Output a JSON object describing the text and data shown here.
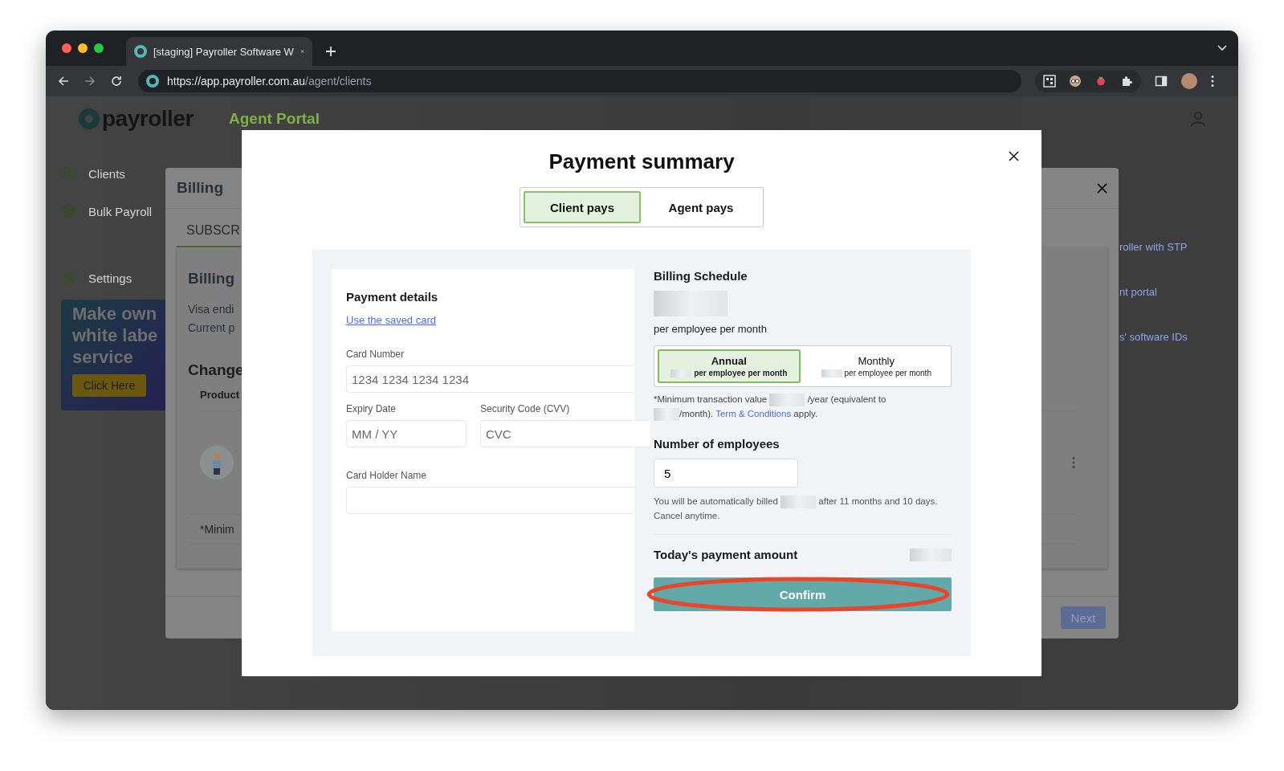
{
  "browser": {
    "tab_title": "[staging] Payroller Software W",
    "url_host": "https://app.payroller.com.au",
    "url_path": "/agent/clients"
  },
  "app": {
    "logo": "payroller",
    "portal_title": "Agent Portal"
  },
  "sidebar": {
    "items": [
      {
        "label": "Clients",
        "kind": "users"
      },
      {
        "label": "Bulk Payroll",
        "kind": "layers"
      },
      {
        "label": "Settings",
        "kind": "gear"
      }
    ],
    "promo": {
      "lines": [
        "Make own",
        "white labe",
        "service"
      ],
      "button": "Click Here"
    }
  },
  "background_links": [
    "roller with STP",
    "nt portal",
    "s' software IDs"
  ],
  "billing_dialog": {
    "title": "Billing",
    "tab": "SUBSCR",
    "section_title": "Billing",
    "lines": [
      "Visa endi",
      "Current p"
    ],
    "change_title": "Change",
    "column_header": "Product",
    "footnote": "*Minim",
    "next_button": "Next"
  },
  "payment_modal": {
    "title": "Payment summary",
    "payer_tabs": [
      {
        "label": "Client pays",
        "selected": true
      },
      {
        "label": "Agent pays",
        "selected": false
      }
    ],
    "payment_details": {
      "title": "Payment details",
      "saved_card_link": "Use the saved card",
      "card_number": {
        "label": "Card Number",
        "placeholder": "1234 1234 1234 1234"
      },
      "expiry": {
        "label": "Expiry Date",
        "placeholder": "MM / YY"
      },
      "cvv": {
        "label": "Security Code (CVV)",
        "placeholder": "CVC"
      },
      "holder": {
        "label": "Card Holder Name"
      }
    },
    "billing_schedule": {
      "title": "Billing Schedule",
      "price_note": "per employee per month",
      "plans": [
        {
          "name": "Annual",
          "note": "per employee per month",
          "selected": true
        },
        {
          "name": "Monthly",
          "note": "per employee per month",
          "selected": false
        }
      ],
      "minimum_note": {
        "lead": "*Minimum transaction value",
        "year": "/year (equivalent to",
        "month": "/month).",
        "link": "Term & Conditions",
        "tail": "apply."
      }
    },
    "employees": {
      "label": "Number of employees",
      "value": "5"
    },
    "billing_info": {
      "lead": "You will be automatically billed",
      "tail": "after 11 months and 10 days.",
      "cancel": "Cancel anytime."
    },
    "today_label": "Today's payment amount",
    "confirm_button": "Confirm"
  }
}
